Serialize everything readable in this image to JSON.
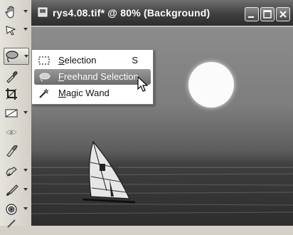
{
  "window": {
    "title": "rys4.08.tif* @  80% (Background)",
    "buttons": [
      "minimize",
      "maximize",
      "close"
    ]
  },
  "toolbar": {
    "tools": [
      {
        "name": "pan-tool",
        "icon": "hand-icon",
        "has_menu": true
      },
      {
        "name": "pick-tool",
        "icon": "pointer-icon",
        "has_menu": true
      },
      {
        "name": "selection-tool",
        "icon": "lasso-icon",
        "has_menu": true,
        "active": true
      },
      {
        "name": "eyedropper-tool",
        "icon": "eyedropper-icon",
        "has_menu": false
      },
      {
        "name": "crop-tool",
        "icon": "crop-icon",
        "has_menu": false
      },
      {
        "name": "straighten-tool",
        "icon": "straighten-icon",
        "has_menu": true
      },
      {
        "name": "red-eye-tool",
        "icon": "eye-icon",
        "has_menu": false
      },
      {
        "name": "makeover-tool",
        "icon": "makeover-icon",
        "has_menu": false
      },
      {
        "name": "clone-tool",
        "icon": "clone-icon",
        "has_menu": true
      },
      {
        "name": "brush-tool",
        "icon": "brush-icon",
        "has_menu": true
      },
      {
        "name": "lighten-tool",
        "icon": "target-icon",
        "has_menu": true
      },
      {
        "name": "smudge-tool",
        "icon": "smudge-icon",
        "has_menu": false
      }
    ]
  },
  "flyout_menu": {
    "items": [
      {
        "label_underlined": "S",
        "label_rest": "election",
        "shortcut": "S",
        "icon": "marquee-icon",
        "highlighted": false
      },
      {
        "label_underlined": "F",
        "label_rest": "reehand Selection",
        "shortcut": "",
        "icon": "lasso-icon",
        "highlighted": true
      },
      {
        "label_underlined": "M",
        "label_rest": "agic Wand",
        "shortcut": "",
        "icon": "magic-wand-icon",
        "highlighted": false
      }
    ]
  },
  "colors": {
    "titlebar": "#3f3f3f",
    "toolbar_bg": "#dcd9d1",
    "menu_highlight": "#7f7f7f",
    "sun": "#fbfbfb"
  }
}
